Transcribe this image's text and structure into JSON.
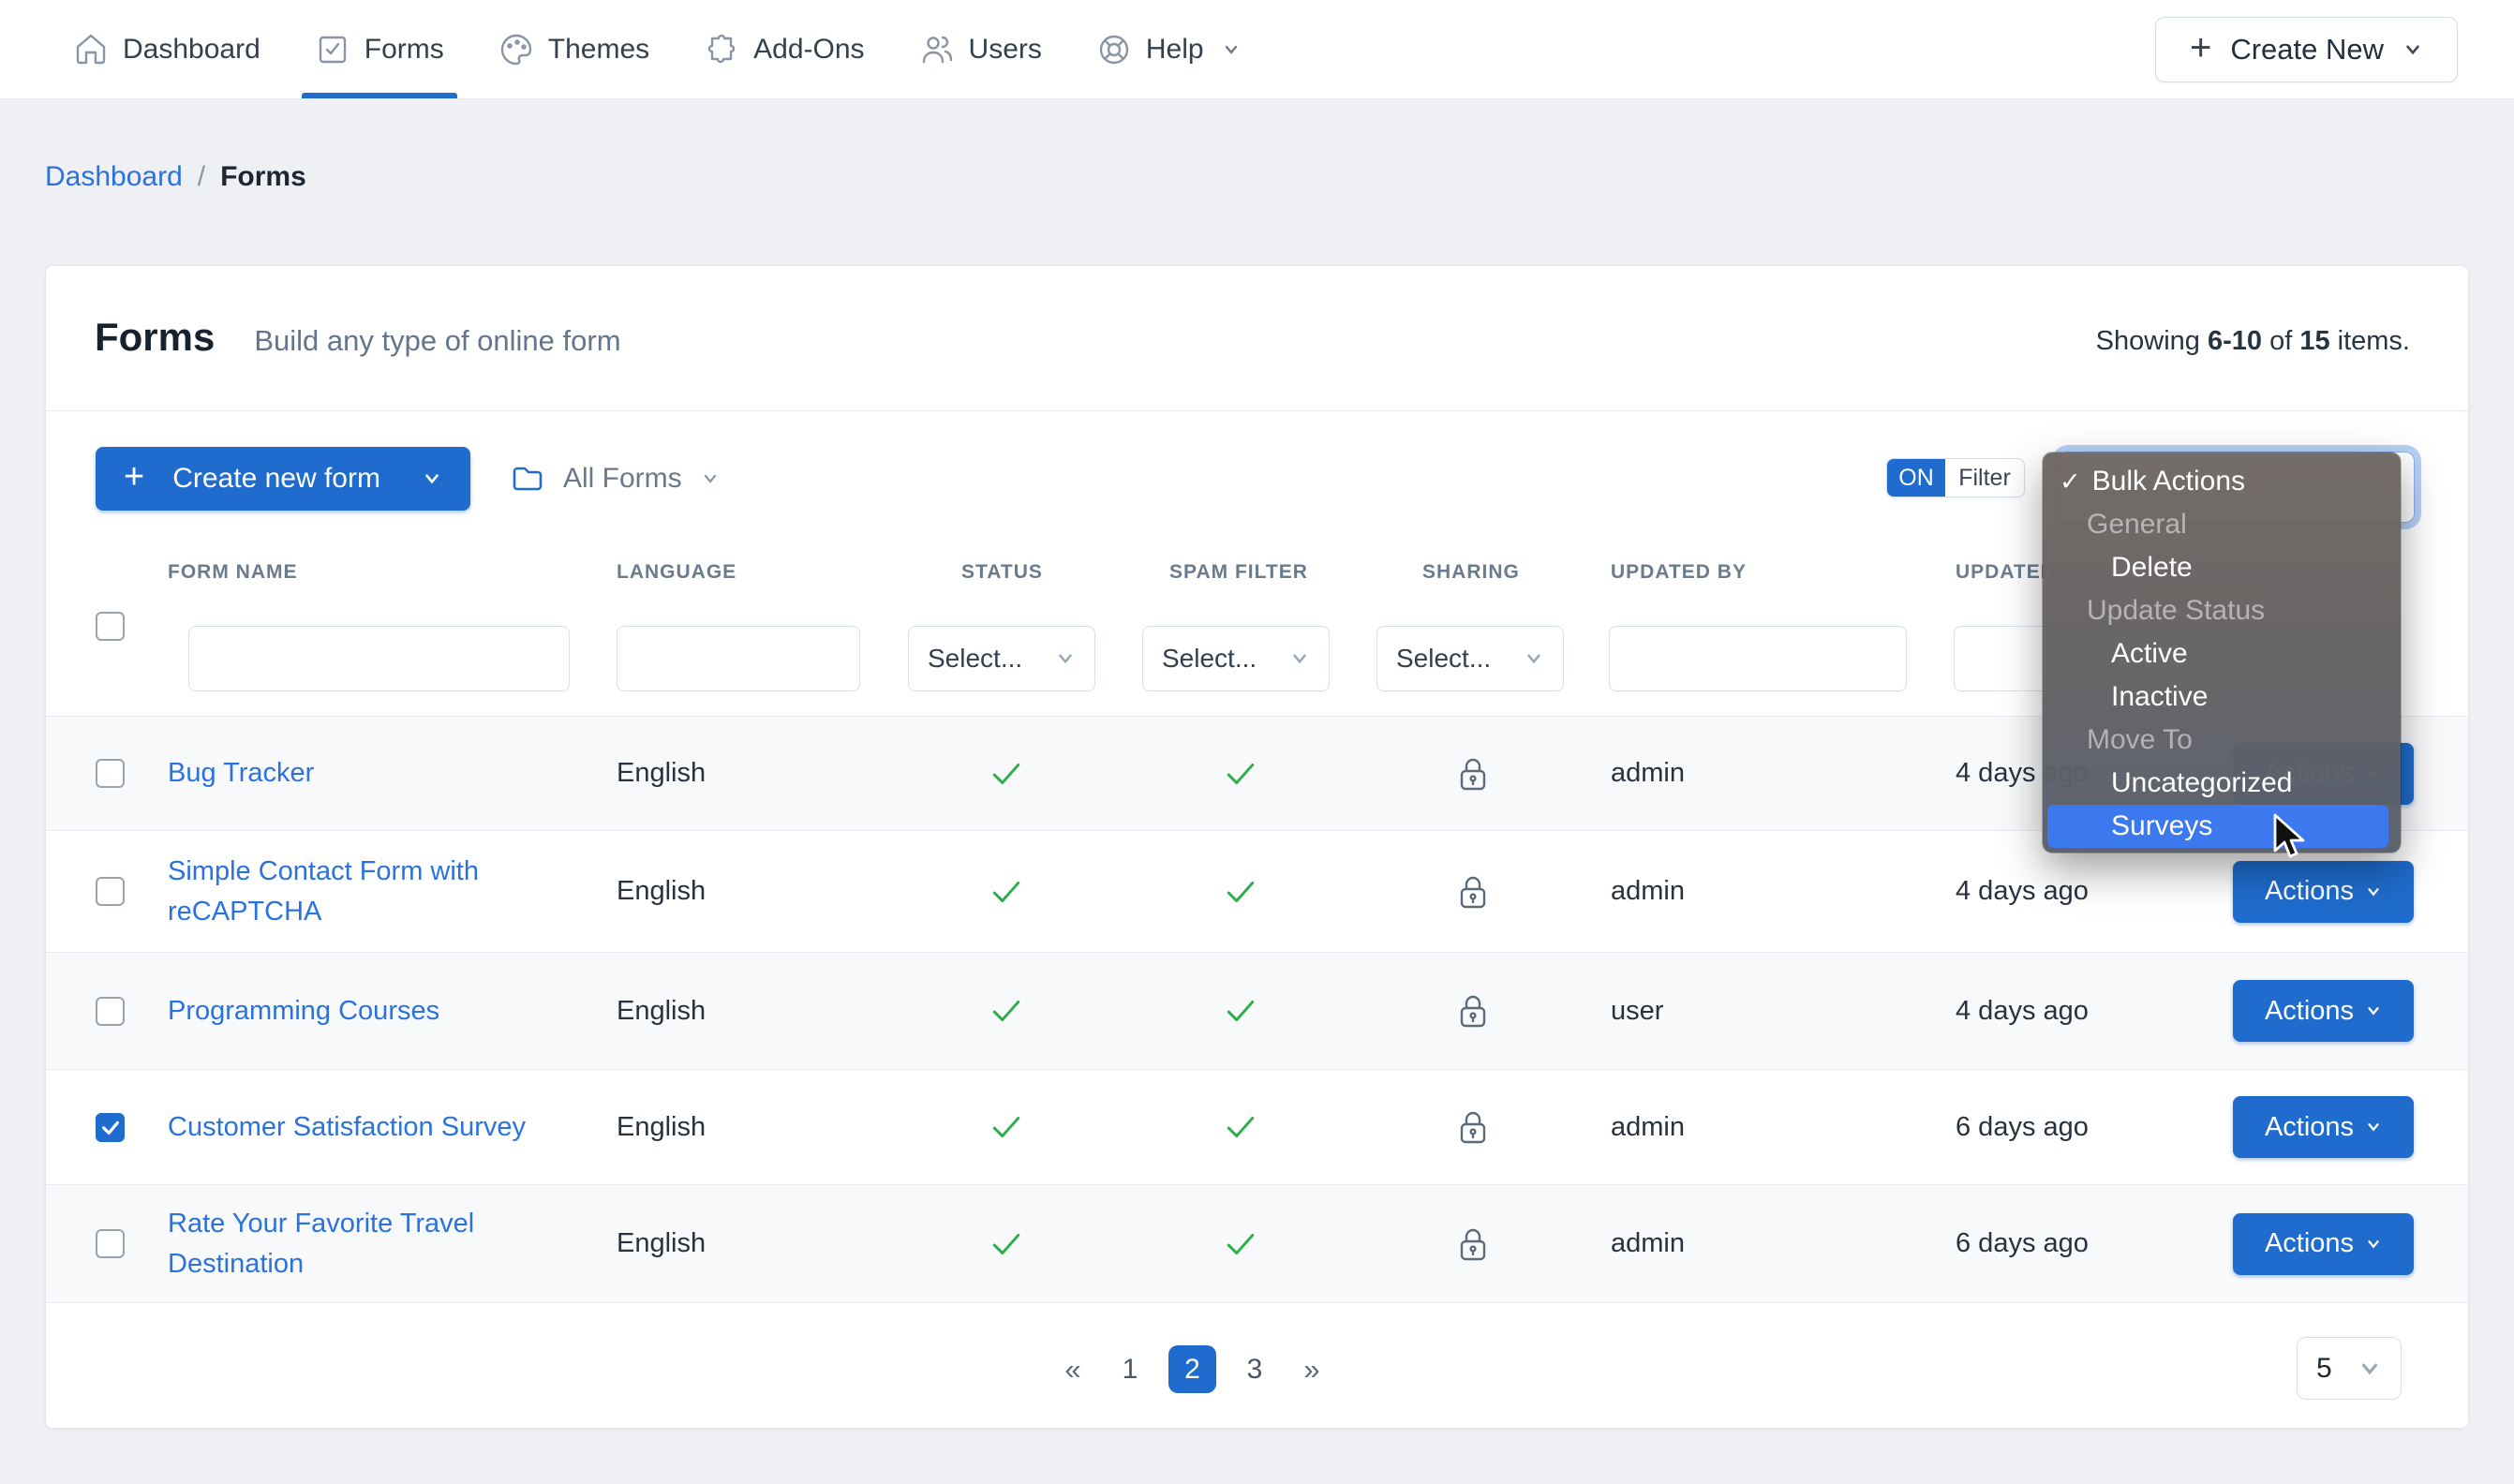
{
  "nav": {
    "items": [
      {
        "label": "Dashboard",
        "icon": "home"
      },
      {
        "label": "Forms",
        "icon": "form-check",
        "active": true
      },
      {
        "label": "Themes",
        "icon": "palette"
      },
      {
        "label": "Add-Ons",
        "icon": "puzzle"
      },
      {
        "label": "Users",
        "icon": "users"
      },
      {
        "label": "Help",
        "icon": "lifebuoy",
        "has_chevron": true
      }
    ],
    "create_new": "Create New"
  },
  "breadcrumb": {
    "link": "Dashboard",
    "separator": "/",
    "current": "Forms"
  },
  "header": {
    "title": "Forms",
    "subtitle": "Build any type of online form",
    "showing_prefix": "Showing ",
    "showing_range": "6-10",
    "showing_of": " of ",
    "showing_total": "15",
    "showing_suffix": " items."
  },
  "toolbar": {
    "create_button": "Create new form",
    "folder_filter": "All Forms",
    "toggle_on": "ON",
    "toggle_filter": "Filter"
  },
  "table": {
    "headers": {
      "name": "FORM NAME",
      "language": "LANGUAGE",
      "status": "STATUS",
      "spam": "SPAM FILTER",
      "sharing": "SHARING",
      "updated_by": "UPDATED BY",
      "updated": "UPDATED"
    },
    "filter_select_placeholder": "Select...",
    "rows": [
      {
        "name": "Bug Tracker",
        "language": "English",
        "status": "active",
        "spam_filter": "active",
        "sharing": "locked",
        "updated_by": "admin",
        "updated": "4 days ago",
        "actions": "Actions",
        "checked": false
      },
      {
        "name": "Simple Contact Form with reCAPTCHA",
        "language": "English",
        "status": "active",
        "spam_filter": "active",
        "sharing": "locked",
        "updated_by": "admin",
        "updated": "4 days ago",
        "actions": "Actions",
        "checked": false
      },
      {
        "name": "Programming Courses",
        "language": "English",
        "status": "active",
        "spam_filter": "active",
        "sharing": "locked",
        "updated_by": "user",
        "updated": "4 days ago",
        "actions": "Actions",
        "checked": false
      },
      {
        "name": "Customer Satisfaction Survey",
        "language": "English",
        "status": "active",
        "spam_filter": "active",
        "sharing": "locked",
        "updated_by": "admin",
        "updated": "6 days ago",
        "actions": "Actions",
        "checked": true
      },
      {
        "name": "Rate Your Favorite Travel Destination",
        "language": "English",
        "status": "active",
        "spam_filter": "active",
        "sharing": "locked",
        "updated_by": "admin",
        "updated": "6 days ago",
        "actions": "Actions",
        "checked": false
      }
    ]
  },
  "bulk_dropdown": {
    "items": [
      {
        "label": "Bulk Actions",
        "type": "selected"
      },
      {
        "label": "General",
        "type": "group"
      },
      {
        "label": "Delete",
        "type": "option"
      },
      {
        "label": "Update Status",
        "type": "group"
      },
      {
        "label": "Active",
        "type": "option"
      },
      {
        "label": "Inactive",
        "type": "option"
      },
      {
        "label": "Move To",
        "type": "group"
      },
      {
        "label": "Uncategorized",
        "type": "option"
      },
      {
        "label": "Surveys",
        "type": "option",
        "highlighted": true
      }
    ]
  },
  "pagination": {
    "prev": "«",
    "page_1": "1",
    "page_2": "2",
    "page_3": "3",
    "next": "»",
    "active_page": "2",
    "page_size": "5"
  },
  "colors": {
    "primary": "#1f6cce",
    "link": "#2b72dd",
    "success_green": "#2eae4a",
    "highlight_blue": "#3c78ee"
  }
}
